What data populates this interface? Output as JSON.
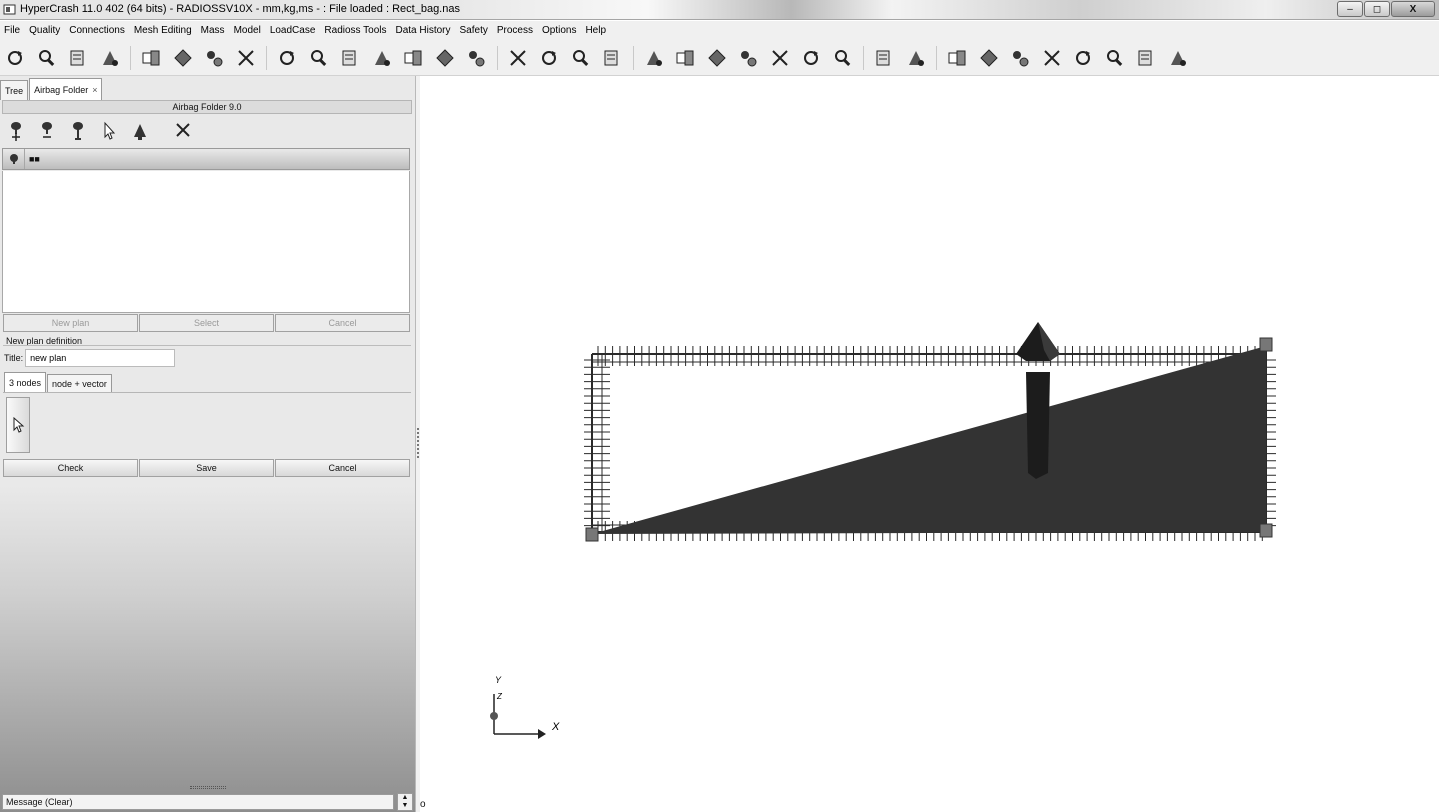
{
  "window": {
    "title": "HyperCrash 11.0 402 (64 bits) - RADIOSSV10X - mm,kg,ms - : File loaded : Rect_bag.nas",
    "minimize": "‒",
    "maximize": "◻",
    "close": "X"
  },
  "menu": [
    "File",
    "Quality",
    "Connections",
    "Mesh Editing",
    "Mass",
    "Model",
    "LoadCase",
    "Radioss Tools",
    "Data History",
    "Safety",
    "Process",
    "Options",
    "Help"
  ],
  "toolbar_groups": [
    [
      "refresh-icon",
      "zoom-icon",
      "quality-check-icon",
      "node-pick-icon"
    ],
    [
      "mesh-split-icon",
      "mesh-merge-icon",
      "mesh-refine-icon",
      "mesh-copy-icon"
    ],
    [
      "connector-icon",
      "weld-icon",
      "spotweld-icon",
      "rivet-icon",
      "bolt-icon",
      "adhesive-icon",
      "hem-icon"
    ],
    [
      "cube-icon",
      "cube-grid-icon",
      "solid-icon",
      "solid-mesh-icon"
    ],
    [
      "airbag-icon",
      "airbag-fold-icon",
      "seatbelt-icon",
      "dummy-icon",
      "barrier-icon",
      "impactor-icon",
      "sensor-icon"
    ],
    [
      "data-history-icon",
      "process-icon"
    ],
    [
      "node-tool-icon",
      "element-tool-icon",
      "translate-tool-icon",
      "rotate-tool-icon",
      "move-tool-icon",
      "align-tool-icon",
      "line-tool-icon",
      "rotate-view-icon"
    ]
  ],
  "left_tabs": [
    {
      "label": "Tree",
      "closable": false,
      "active": false
    },
    {
      "label": "Airbag Folder",
      "closable": true,
      "active": true
    }
  ],
  "tab_close": "×",
  "folder": {
    "header": "Airbag Folder 9.0",
    "tools": [
      "airbag-add-icon",
      "airbag-remove-icon",
      "airbag-info-icon",
      "select-arrow-icon",
      "bell-icon",
      "close-icon"
    ],
    "list_column": "■■"
  },
  "plan_buttons": {
    "new_plan": "New plan",
    "select": "Select",
    "cancel": "Cancel"
  },
  "new_plan_definition": {
    "section_label": "New plan definition",
    "title_label": "Title:",
    "title_value": "new plan",
    "tabs": [
      "3 nodes",
      "node + vector"
    ]
  },
  "action_buttons": {
    "check": "Check",
    "save": "Save",
    "cancel": "Cancel"
  },
  "message": {
    "label": "Message (Clear)",
    "spin_up": "▲",
    "spin_down": "▼"
  },
  "status_char": "o",
  "axes": {
    "x_label": "X",
    "y_label": "Y",
    "z_label": "Z"
  },
  "colors": {
    "mesh": "#2a2a2a",
    "fill": "#333333",
    "arrow": "#1c1c1c"
  }
}
